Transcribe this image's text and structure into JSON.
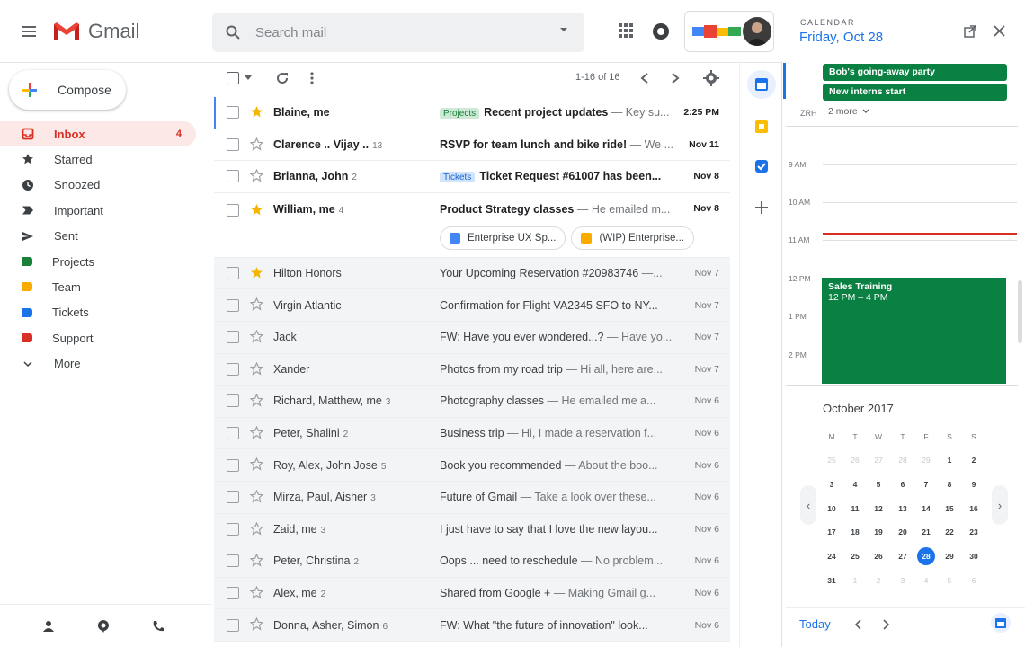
{
  "header": {
    "app_name": "Gmail",
    "search_placeholder": "Search mail"
  },
  "sidebar": {
    "compose_label": "Compose",
    "items": [
      {
        "label": "Inbox",
        "count": "4",
        "icon": "inbox-icon"
      },
      {
        "label": "Starred",
        "icon": "star-icon"
      },
      {
        "label": "Snoozed",
        "icon": "clock-icon"
      },
      {
        "label": "Important",
        "icon": "important-icon"
      },
      {
        "label": "Sent",
        "icon": "send-icon"
      },
      {
        "label": "Projects",
        "icon": "label-icon",
        "color": "#188038"
      },
      {
        "label": "Team",
        "icon": "label-icon",
        "color": "#f9ab00"
      },
      {
        "label": "Tickets",
        "icon": "label-icon",
        "color": "#1a73e8"
      },
      {
        "label": "Support",
        "icon": "label-icon",
        "color": "#d93025"
      },
      {
        "label": "More",
        "icon": "chevron-down-icon"
      }
    ]
  },
  "toolbar": {
    "pager": "1-16 of 16"
  },
  "emails": [
    {
      "sender": "Blaine, me",
      "count": "",
      "tag": "Projects",
      "tag_color": "green",
      "subject": "Recent project updates",
      "snippet": " — Key su...",
      "date": "2:25 PM",
      "unread": true,
      "starred": true
    },
    {
      "sender": "Clarence .. Vijay ..",
      "count": "13",
      "tag": "",
      "subject": "RSVP for team lunch and bike ride!",
      "snippet": " — We ...",
      "date": "Nov 11",
      "unread": true,
      "starred": false
    },
    {
      "sender": "Brianna, John",
      "count": "2",
      "tag": "Tickets",
      "tag_color": "blue",
      "subject": "Ticket Request #61007 has been...",
      "snippet": "",
      "date": "Nov 8",
      "unread": true,
      "starred": false
    },
    {
      "sender": "William, me",
      "count": "4",
      "tag": "",
      "subject": "Product Strategy classes",
      "snippet": " — He emailed m...",
      "date": "Nov 8",
      "unread": true,
      "starred": true,
      "attachments": [
        {
          "label": "Enterprise UX Sp...",
          "color": "#4285f4"
        },
        {
          "label": "(WIP) Enterprise...",
          "color": "#f9ab00"
        }
      ]
    },
    {
      "sender": "Hilton Honors",
      "count": "",
      "subject": "Your Upcoming Reservation #20983746",
      "snippet": " —...",
      "date": "Nov 7",
      "unread": false,
      "starred": true
    },
    {
      "sender": "Virgin Atlantic",
      "count": "",
      "subject": "Confirmation for Flight VA2345 SFO to NY...",
      "snippet": "",
      "date": "Nov 7",
      "unread": false,
      "starred": false
    },
    {
      "sender": "Jack",
      "count": "",
      "subject": "FW: Have you ever wondered...?",
      "snippet": " — Have yo...",
      "date": "Nov 7",
      "unread": false,
      "starred": false
    },
    {
      "sender": "Xander",
      "count": "",
      "subject": "Photos from my road trip",
      "snippet": " — Hi all, here are...",
      "date": "Nov 7",
      "unread": false,
      "starred": false
    },
    {
      "sender": "Richard, Matthew, me",
      "count": "3",
      "subject": "Photography classes",
      "snippet": " — He emailed me a...",
      "date": "Nov 6",
      "unread": false,
      "starred": false
    },
    {
      "sender": "Peter, Shalini",
      "count": "2",
      "subject": "Business trip",
      "snippet": " — Hi, I made a reservation f...",
      "date": "Nov 6",
      "unread": false,
      "starred": false
    },
    {
      "sender": "Roy, Alex, John Jose",
      "count": "5",
      "subject": "Book you recommended",
      "snippet": " — About the boo...",
      "date": "Nov 6",
      "unread": false,
      "starred": false
    },
    {
      "sender": "Mirza, Paul, Aisher",
      "count": "3",
      "subject": "Future of Gmail",
      "snippet": " — Take a look over these...",
      "date": "Nov 6",
      "unread": false,
      "starred": false
    },
    {
      "sender": "Zaid, me",
      "count": "3",
      "subject": "I just have to say that I love the new layou...",
      "snippet": "",
      "date": "Nov 6",
      "unread": false,
      "starred": false
    },
    {
      "sender": "Peter, Christina",
      "count": "2",
      "subject": "Oops ... need to reschedule",
      "snippet": " — No problem...",
      "date": "Nov 6",
      "unread": false,
      "starred": false
    },
    {
      "sender": "Alex, me",
      "count": "2",
      "subject": "Shared from Google +",
      "snippet": " — Making Gmail g...",
      "date": "Nov 6",
      "unread": false,
      "starred": false
    },
    {
      "sender": "Donna, Asher, Simon",
      "count": "6",
      "subject": "FW: What \"the future of innovation\" look...",
      "snippet": "",
      "date": "Nov 6",
      "unread": false,
      "starred": false
    }
  ],
  "calendar": {
    "panel_label": "CALENDAR",
    "date_title": "Friday, Oct 28",
    "all_day_events": [
      "Bob's going-away party",
      "New interns start"
    ],
    "allday_zone": "ZRH",
    "more_label": "2 more",
    "hours": [
      "9 AM",
      "10 AM",
      "11 AM",
      "12 PM",
      "1 PM",
      "2 PM"
    ],
    "event": {
      "title": "Sales Training",
      "time": "12 PM – 4 PM"
    },
    "month_title": "October 2017",
    "weekdays": [
      "M",
      "T",
      "W",
      "T",
      "F",
      "S",
      "S"
    ],
    "weeks": [
      [
        "25",
        "26",
        "27",
        "28",
        "29",
        "1",
        "2"
      ],
      [
        "3",
        "4",
        "5",
        "6",
        "7",
        "8",
        "9"
      ],
      [
        "10",
        "11",
        "12",
        "13",
        "14",
        "15",
        "16"
      ],
      [
        "17",
        "18",
        "19",
        "20",
        "21",
        "22",
        "23"
      ],
      [
        "24",
        "25",
        "26",
        "27",
        "28",
        "29",
        "30"
      ],
      [
        "31",
        "1",
        "2",
        "3",
        "4",
        "5",
        "6"
      ]
    ],
    "today_label": "Today",
    "accent": "#1a73e8",
    "event_color": "#0b8043"
  }
}
